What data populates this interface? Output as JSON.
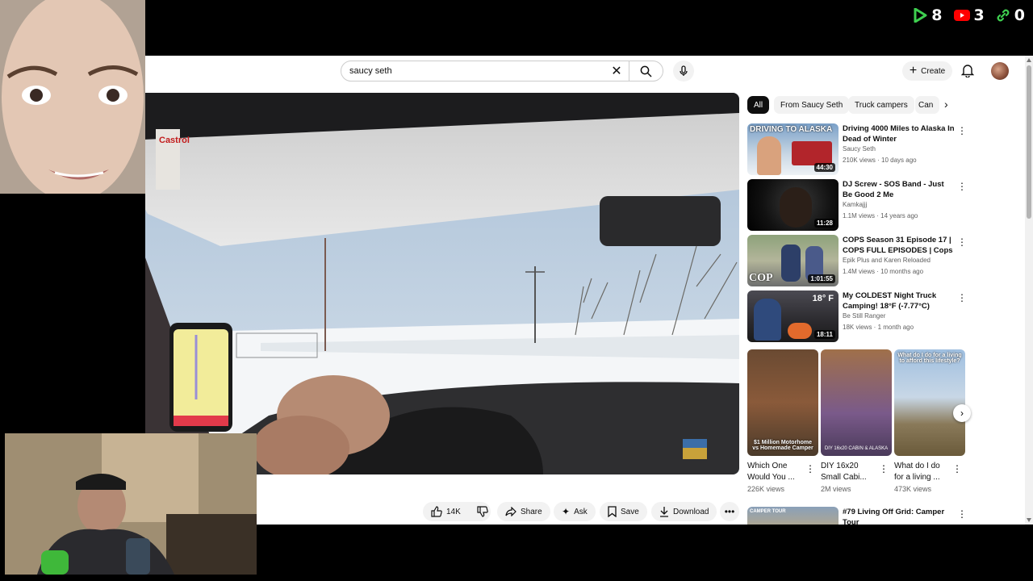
{
  "overlay": {
    "counters": [
      {
        "icon": "play-icon",
        "value": "8",
        "color": "#3ecf4f"
      },
      {
        "icon": "youtube-icon",
        "value": "3",
        "color": "#ff0000"
      },
      {
        "icon": "link-icon",
        "value": "0",
        "color": "#3ecf4f"
      }
    ]
  },
  "header": {
    "search_query": "saucy seth",
    "create_label": "Create"
  },
  "actions": {
    "likes": "14K",
    "share": "Share",
    "ask": "Ask",
    "save": "Save",
    "download": "Download"
  },
  "chips": [
    "All",
    "From Saucy Seth",
    "Truck campers",
    "Can"
  ],
  "recommendations": [
    {
      "title": "Driving 4000 Miles to Alaska In Dead of Winter",
      "channel": "Saucy Seth",
      "meta": "210K views · 10 days ago",
      "duration": "44:30",
      "thumb_text": "DRIVING TO ALASKA"
    },
    {
      "title": "DJ Screw - SOS Band - Just Be Good 2 Me",
      "channel": "Kamkajjj",
      "meta": "1.1M views · 14 years ago",
      "duration": "11:28",
      "thumb_text": ""
    },
    {
      "title": "COPS Season 31 Episode 17 | COPS FULL EPISODES | Cops ...",
      "channel": "Epik Plus  and Karen Reloaded",
      "meta": "1.4M views · 10 months ago",
      "duration": "1:01:55",
      "thumb_text": "COP"
    },
    {
      "title": "My COLDEST Night Truck Camping! 18°F (-7.77°C)",
      "channel": "Be Still Ranger",
      "meta": "18K views · 1 month ago",
      "duration": "18:11",
      "thumb_text": "18° F"
    }
  ],
  "shorts": [
    {
      "title": "Which One Would You ...",
      "views": "226K views",
      "thumb_text": "$1 Million Motorhome vs Homemade Camper"
    },
    {
      "title": "DIY 16x20 Small Cabi...",
      "views": "2M views",
      "thumb_text": "DIY 16x20 CABIN & ALASKA"
    },
    {
      "title": "What do I do for a living ...",
      "views": "473K views",
      "thumb_text": "What do I do for a living to afford this lifestyle?"
    }
  ],
  "last_rec": {
    "title": "#79 Living Off Grid: Camper Tour",
    "thumb_text": "CAMPER TOUR"
  },
  "video": {
    "sticker": "Castrol"
  }
}
